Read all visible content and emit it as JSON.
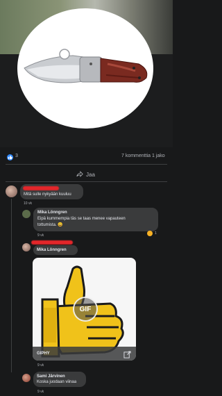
{
  "post": {
    "like_count": "3",
    "comments_shares": "7 kommenttia  1 jako",
    "share_label": "Jaa"
  },
  "comments": [
    {
      "text": "Mitä sulle nykyään kuuluu",
      "time": "10 vk"
    },
    {
      "author": "Mika Lönngren",
      "text_line1": "Eipä kummempia täs se taas menee vapauteen",
      "text_line2": "tottumista. 😀",
      "time": "9 vk",
      "reaction_count": "1"
    },
    {
      "author": "Mika Lönngren",
      "gif_source": "GIPHY",
      "gif_badge": "GIF",
      "time": "9 vk"
    },
    {
      "author": "Sami Järvinen",
      "text": "Koska juodaan viinaa",
      "time": "9 vk"
    }
  ],
  "colors": {
    "background": "#18191a",
    "bubble": "#3a3b3c",
    "like_blue": "#2d88ff",
    "redaction_red": "#e3262a"
  },
  "icons": [
    "like-icon",
    "share-icon",
    "reaction-icon",
    "open-external-icon"
  ]
}
